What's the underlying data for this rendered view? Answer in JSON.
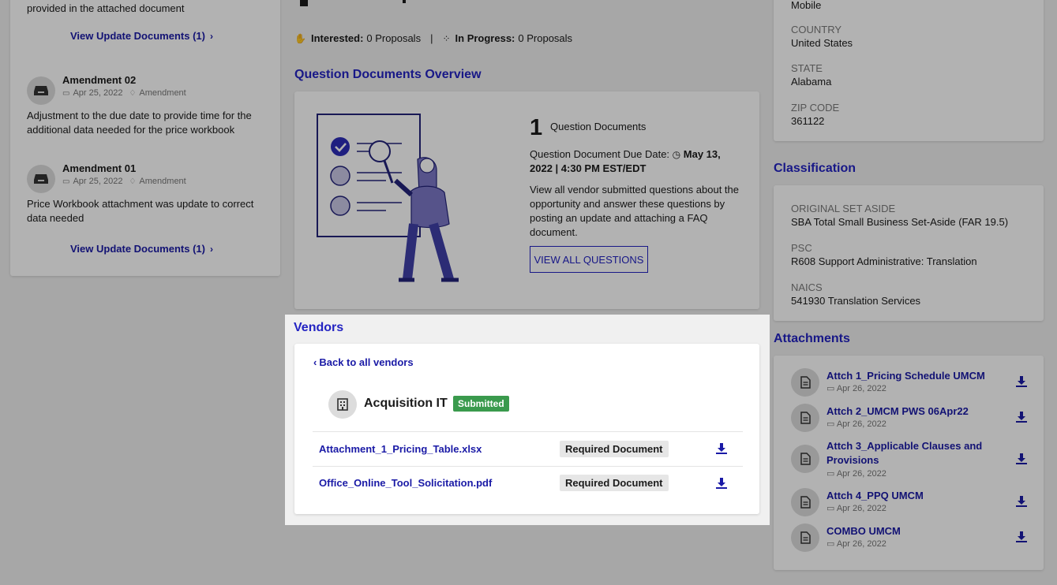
{
  "left": {
    "top_text": "provided in the attached document",
    "view_update_1": "View Update Documents (1)",
    "amendments": [
      {
        "title": "Amendment 02",
        "date": "Apr 25, 2022",
        "type": "Amendment",
        "desc": "Adjustment to the due date to provide time for the additional data needed for the price workbook"
      },
      {
        "title": "Amendment 01",
        "date": "Apr 25, 2022",
        "type": "Amendment",
        "desc": "Price Workbook attachment was update to correct data needed"
      }
    ],
    "view_update_2": "View Update Documents (1)"
  },
  "status": {
    "interested_label": "Interested:",
    "interested_value": "0 Proposals",
    "separator": "|",
    "progress_label": "In Progress:",
    "progress_value": "0 Proposals"
  },
  "questions": {
    "title": "Question Documents Overview",
    "count": "1",
    "count_label": "Question Documents",
    "due_label": "Question Document Due Date:",
    "due_value": "May 13, 2022 | 4:30 PM EST/EDT",
    "description": "View all vendor submitted questions about the opportunity and answer these questions by posting an update and attaching a FAQ document.",
    "button": "VIEW ALL QUESTIONS"
  },
  "vendors": {
    "title": "Vendors",
    "back": "Back to all vendors",
    "vendor_name": "Acquisition IT",
    "vendor_status": "Submitted",
    "documents": [
      {
        "name": "Attachment_1_Pricing_Table.xlsx",
        "tag": "Required Document"
      },
      {
        "name": "Office_Online_Tool_Solicitation.pdf",
        "tag": "Required Document"
      }
    ]
  },
  "right": {
    "device_value": "Mobile",
    "location": [
      {
        "label": "COUNTRY",
        "value": "United States"
      },
      {
        "label": "STATE",
        "value": "Alabama"
      },
      {
        "label": "ZIP CODE",
        "value": "361122"
      }
    ],
    "classification_title": "Classification",
    "classification": [
      {
        "label": "ORIGINAL SET ASIDE",
        "value": "SBA Total Small Business Set-Aside (FAR 19.5)"
      },
      {
        "label": "PSC",
        "value": "R608 Support Administrative: Translation"
      },
      {
        "label": "NAICS",
        "value": "541930 Translation Services"
      }
    ],
    "attachments_title": "Attachments",
    "attachments": [
      {
        "name": "Attch 1_Pricing Schedule UMCM",
        "date": "Apr 26, 2022"
      },
      {
        "name": "Attch 2_UMCM PWS 06Apr22",
        "date": "Apr 26, 2022"
      },
      {
        "name": "Attch 3_Applicable Clauses and Provisions",
        "date": "Apr 26, 2022"
      },
      {
        "name": "Attch 4_PPQ UMCM",
        "date": "Apr 26, 2022"
      },
      {
        "name": "COMBO UMCM",
        "date": "Apr 26, 2022"
      }
    ]
  },
  "colors": {
    "accent": "#2323c2",
    "success": "#3a9a4d",
    "overlay": "rgba(0,0,0,0.30)"
  }
}
